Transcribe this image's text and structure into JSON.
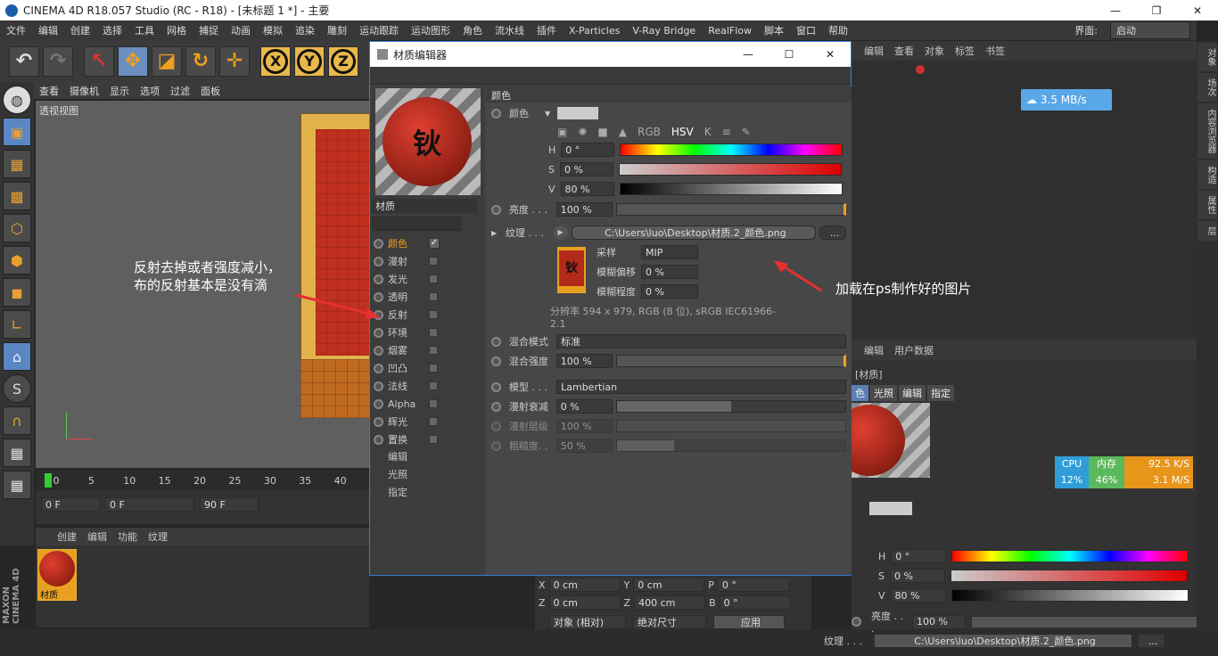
{
  "window": {
    "title": "CINEMA 4D R18.057 Studio (RC - R18) - [未标题 1 *] - 主要",
    "min": "—",
    "restore": "❐",
    "close": "✕"
  },
  "menu": [
    "文件",
    "编辑",
    "创建",
    "选择",
    "工具",
    "网格",
    "捕捉",
    "动画",
    "模拟",
    "追染",
    "雕刻",
    "运动跟踪",
    "运动图形",
    "角色",
    "流水线",
    "插件",
    "X-Particles",
    "V-Ray Bridge",
    "RealFlow",
    "脚本",
    "窗口",
    "帮助"
  ],
  "interface_label": "界面:",
  "interface_value": "启动",
  "viewport": {
    "menu": [
      "查看",
      "摄像机",
      "显示",
      "选项",
      "过滤",
      "面板"
    ],
    "label": "透视视图"
  },
  "timeline": {
    "ticks": [
      "0",
      "5",
      "10",
      "15",
      "20",
      "25",
      "30",
      "35",
      "40"
    ],
    "start": "0 F",
    "range_start": "0 F",
    "range_end": "90 F",
    "end": "90 F"
  },
  "matmgr": {
    "menu": [
      "创建",
      "编辑",
      "功能",
      "纹理"
    ],
    "mat_name": "材质"
  },
  "brand": "MAXON CINEMA 4D",
  "dialog": {
    "title": "材质编辑器",
    "mat_name": "材质",
    "channels": [
      {
        "label": "颜色",
        "checked": true
      },
      {
        "label": "漫射",
        "checked": false
      },
      {
        "label": "发光",
        "checked": false
      },
      {
        "label": "透明",
        "checked": false
      },
      {
        "label": "反射",
        "checked": false
      },
      {
        "label": "环境",
        "checked": false
      },
      {
        "label": "烟雾",
        "checked": false
      },
      {
        "label": "凹凸",
        "checked": false
      },
      {
        "label": "法线",
        "checked": false
      },
      {
        "label": "Alpha",
        "checked": false
      },
      {
        "label": "辉光",
        "checked": false
      },
      {
        "label": "置换",
        "checked": false
      }
    ],
    "extra": [
      "编辑",
      "光照",
      "指定"
    ],
    "section": "颜色",
    "color_label": "颜色",
    "h_label": "H",
    "h_val": "0 °",
    "s_label": "S",
    "s_val": "0 %",
    "v_label": "V",
    "v_val": "80 %",
    "brightness_label": "亮度 . . .",
    "brightness_val": "100 %",
    "texture_label": "纹理 . . .",
    "texture_path": "C:\\Users\\luo\\Desktop\\材质.2_颜色.png",
    "texture_more": "...",
    "sampling_label": "采样",
    "sampling_val": "MIP",
    "blur_offset_label": "模糊偏移",
    "blur_offset_val": "0 %",
    "blur_scale_label": "模糊程度",
    "blur_scale_val": "0 %",
    "resolution": "分辨率 594 x 979, RGB (8 位), sRGB IEC61966-2.1",
    "mix_mode_label": "混合模式",
    "mix_mode_val": "标准",
    "mix_strength_label": "混合强度",
    "mix_strength_val": "100 %",
    "model_label": "模型 . . .",
    "model_val": "Lambertian",
    "diffuse_falloff_label": "漫射衰减",
    "diffuse_falloff_val": "0 %",
    "diffuse_level_label": "漫射层级",
    "diffuse_level_val": "100 %",
    "roughness_label": "粗糙度. .",
    "roughness_val": "50 %"
  },
  "annotations": {
    "left": "反射去掉或者强度减小，\n布的反射基本是没有滴",
    "right": "加载在ps制作好的图片"
  },
  "objmgr": {
    "menu": [
      "编辑",
      "查看",
      "对象",
      "标签",
      "书签"
    ],
    "net_speed": "3.5 MB/s"
  },
  "attr": {
    "menu": [
      "编辑",
      "用户数据"
    ],
    "title": "[材质]",
    "tabs": [
      "色",
      "光照",
      "编辑",
      "指定"
    ],
    "h_val": "0 °",
    "s_val": "0 %",
    "v_val": "80 %",
    "brightness_label": "亮度 . . .",
    "brightness_val": "100 %",
    "texture_label": "纹理 . . .",
    "texture_path": "C:\\Users\\luo\\Desktop\\材质.2_颜色.png",
    "more": "..."
  },
  "coords": {
    "x_label": "X",
    "x_val": "0 cm",
    "z_label": "Z",
    "z_val": "0 cm",
    "y_label": "Y",
    "y_val": "0 cm",
    "z2_label": "Z",
    "z2_val": "400 cm",
    "p_label": "P",
    "p_val": "0 °",
    "b_label": "B",
    "b_val": "0 °",
    "mode": "对象 (相对)",
    "size": "绝对尺寸",
    "apply": "应用"
  },
  "monitor": {
    "cpu_label": "CPU",
    "cpu_val": "12%",
    "mem_label": "内存",
    "mem_val": "46%",
    "up": "92.5 K/S",
    "down": "3.1 M/S"
  },
  "right_tabs": [
    "对象",
    "场次",
    "内容浏览器",
    "构造",
    "属性",
    "层"
  ]
}
